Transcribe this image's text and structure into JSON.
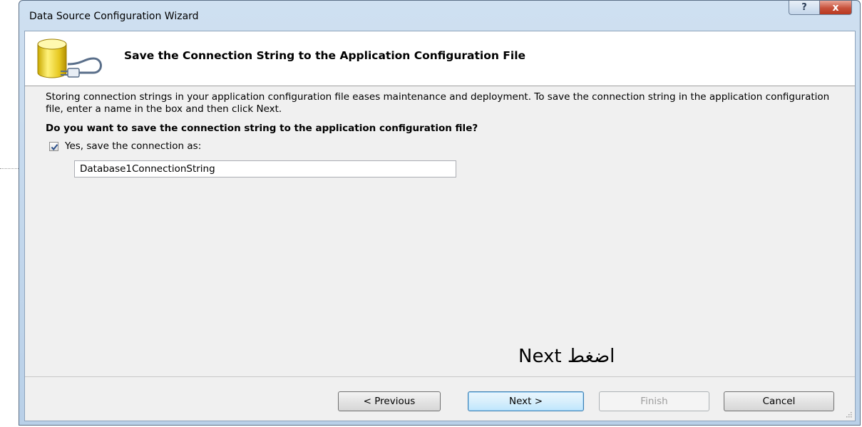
{
  "window": {
    "title": "Data Source Configuration Wizard",
    "help_symbol": "?",
    "close_symbol": "x"
  },
  "header": {
    "title": "Save the Connection String to the Application Configuration File",
    "icon": "database-connection-icon"
  },
  "body": {
    "description": "Storing connection strings in your application configuration file eases maintenance and deployment. To save the connection string in the application configuration file, enter a name in the box and then click Next.",
    "question": "Do you want to save the connection string to the application configuration file?",
    "checkbox": {
      "label": "Yes, save the connection as:",
      "checked": true
    },
    "connection_name": "Database1ConnectionString"
  },
  "annotation": "اضغط Next",
  "buttons": {
    "previous": "< Previous",
    "next": "Next >",
    "finish": "Finish",
    "cancel": "Cancel"
  },
  "colors": {
    "client_bg": "#f0f0f0",
    "close_button": "#c7513b",
    "default_button_border": "#3c7fb1"
  }
}
